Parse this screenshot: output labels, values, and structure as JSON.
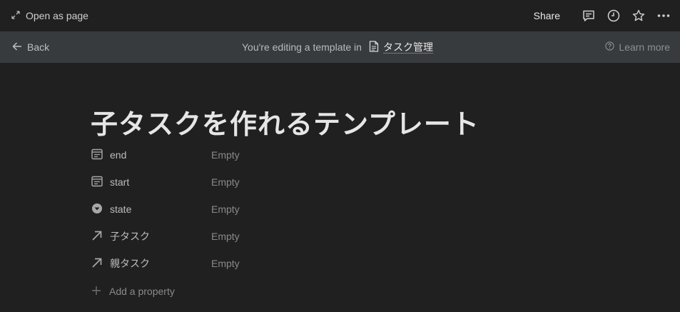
{
  "topbar": {
    "open_as_page": "Open as page",
    "share": "Share"
  },
  "banner": {
    "back": "Back",
    "editing_text": "You're editing a template in",
    "database_name": "タスク管理",
    "learn_more": "Learn more"
  },
  "page": {
    "title": "子タスクを作れるテンプレート"
  },
  "properties": [
    {
      "name": "end",
      "value": "Empty",
      "icon": "calendar-icon"
    },
    {
      "name": "start",
      "value": "Empty",
      "icon": "calendar-icon"
    },
    {
      "name": "state",
      "value": "Empty",
      "icon": "select-icon"
    },
    {
      "name": "子タスク",
      "value": "Empty",
      "icon": "relation-arrow-icon"
    },
    {
      "name": "親タスク",
      "value": "Empty",
      "icon": "relation-arrow-icon"
    }
  ],
  "add_property": "Add a property",
  "colors": {
    "background": "#202020",
    "banner": "#383b3e",
    "text_primary": "#e6e6e6",
    "text_muted": "#8a8a8a"
  }
}
